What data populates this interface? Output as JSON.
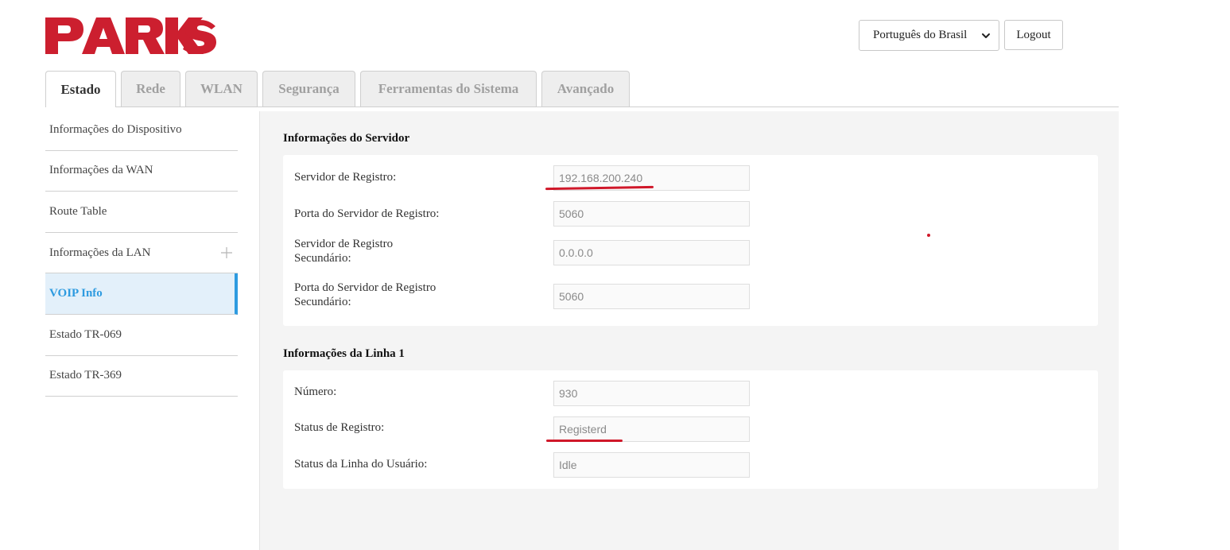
{
  "brand": {
    "logo_text": "PARKS",
    "logo_color": "#cc1f2f"
  },
  "header": {
    "language": {
      "selected": "Português do Brasil"
    },
    "logout_label": "Logout"
  },
  "tabs": [
    {
      "label": "Estado",
      "active": true
    },
    {
      "label": "Rede",
      "active": false
    },
    {
      "label": "WLAN",
      "active": false
    },
    {
      "label": "Segurança",
      "active": false
    },
    {
      "label": "Ferramentas do Sistema",
      "active": false
    },
    {
      "label": "Avançado",
      "active": false
    }
  ],
  "sidebar": {
    "items": [
      {
        "label": "Informações do Dispositivo"
      },
      {
        "label": "Informações da WAN"
      },
      {
        "label": "Route Table"
      },
      {
        "label": "Informações da LAN",
        "expand_icon": "plus-icon"
      },
      {
        "label": "VOIP Info",
        "active": true
      },
      {
        "label": "Estado TR-069"
      },
      {
        "label": "Estado TR-369"
      }
    ]
  },
  "server_info": {
    "title": "Informações do Servidor",
    "fields": [
      {
        "label": "Servidor de Registro:",
        "value": "192.168.200.240"
      },
      {
        "label": "Porta do Servidor de Registro:",
        "value": "5060"
      },
      {
        "label": "Servidor de Registro Secundário:",
        "value": "0.0.0.0"
      },
      {
        "label": "Porta do Servidor de Registro Secundário:",
        "value": "5060"
      }
    ]
  },
  "line1_info": {
    "title": "Informações da Linha 1",
    "fields": [
      {
        "label": "Número:",
        "value": "930"
      },
      {
        "label": "Status de Registro:",
        "value": "Registerd"
      },
      {
        "label": "Status da Linha do Usuário:",
        "value": "Idle"
      }
    ]
  },
  "colors": {
    "accent": "#2e9be0",
    "annotation": "#d0182a",
    "content_bg": "#f4f4f4"
  }
}
